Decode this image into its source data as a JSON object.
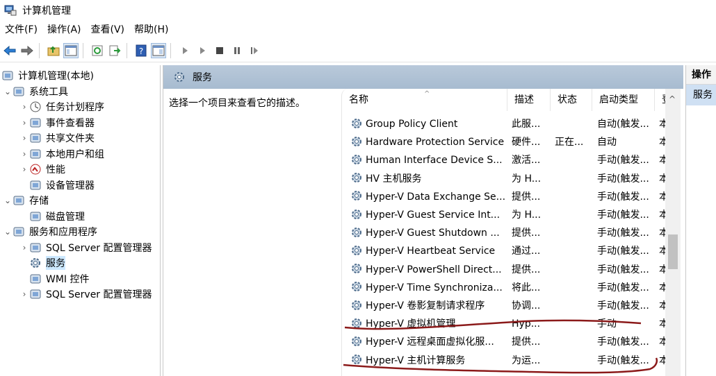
{
  "window": {
    "title": "计算机管理"
  },
  "menu": [
    "文件(F)",
    "操作(A)",
    "查看(V)",
    "帮助(H)"
  ],
  "toolbar_icons": [
    "back-arrow-icon",
    "forward-arrow-icon",
    "up-folder-icon",
    "show-hide-tree-icon",
    "refresh-icon",
    "export-list-icon",
    "help-icon",
    "properties-icon",
    "play-icon",
    "play-alt-icon",
    "stop-icon",
    "pause-icon",
    "restart-icon"
  ],
  "tree": [
    {
      "label": "计算机管理(本地)",
      "level": 0,
      "twisty": "",
      "icon": "computer-management-icon"
    },
    {
      "label": "系统工具",
      "level": 1,
      "twisty": "⌄",
      "icon": "tools-icon"
    },
    {
      "label": "任务计划程序",
      "level": 2,
      "twisty": "›",
      "icon": "clock-icon"
    },
    {
      "label": "事件查看器",
      "level": 2,
      "twisty": "›",
      "icon": "event-viewer-icon"
    },
    {
      "label": "共享文件夹",
      "level": 2,
      "twisty": "›",
      "icon": "shared-folder-icon"
    },
    {
      "label": "本地用户和组",
      "level": 2,
      "twisty": "›",
      "icon": "users-icon"
    },
    {
      "label": "性能",
      "level": 2,
      "twisty": "›",
      "icon": "performance-icon"
    },
    {
      "label": "设备管理器",
      "level": 2,
      "twisty": "",
      "icon": "device-manager-icon"
    },
    {
      "label": "存储",
      "level": 1,
      "twisty": "⌄",
      "icon": "storage-icon"
    },
    {
      "label": "磁盘管理",
      "level": 2,
      "twisty": "",
      "icon": "disk-icon"
    },
    {
      "label": "服务和应用程序",
      "level": 1,
      "twisty": "⌄",
      "icon": "services-apps-icon"
    },
    {
      "label": "SQL Server 配置管理器",
      "level": 2,
      "twisty": "›",
      "icon": "sql-server-icon"
    },
    {
      "label": "服务",
      "level": 2,
      "twisty": "",
      "icon": "gear-icon",
      "selected": true
    },
    {
      "label": "WMI 控件",
      "level": 2,
      "twisty": "",
      "icon": "wmi-icon"
    },
    {
      "label": "SQL Server 配置管理器",
      "level": 2,
      "twisty": "›",
      "icon": "sql-server-icon"
    }
  ],
  "panel": {
    "title": "服务",
    "description": "选择一个项目来查看它的描述。"
  },
  "columns": {
    "name": "名称",
    "description": "描述",
    "status": "状态",
    "startup": "启动类型",
    "logon": "登"
  },
  "services": [
    {
      "name": "Group Policy Client",
      "description": "此服...",
      "status": "",
      "startup": "自动(触发...",
      "logon": "本"
    },
    {
      "name": "Hardware Protection Service",
      "description": "硬件...",
      "status": "正在...",
      "startup": "自动",
      "logon": "本"
    },
    {
      "name": "Human Interface Device S...",
      "description": "激活...",
      "status": "",
      "startup": "手动(触发...",
      "logon": "本"
    },
    {
      "name": "HV 主机服务",
      "description": "为 H...",
      "status": "",
      "startup": "手动(触发...",
      "logon": "本"
    },
    {
      "name": "Hyper-V Data Exchange Se...",
      "description": "提供...",
      "status": "",
      "startup": "手动(触发...",
      "logon": "本"
    },
    {
      "name": "Hyper-V Guest Service Int...",
      "description": "为 H...",
      "status": "",
      "startup": "手动(触发...",
      "logon": "本"
    },
    {
      "name": "Hyper-V Guest Shutdown ...",
      "description": "提供...",
      "status": "",
      "startup": "手动(触发...",
      "logon": "本"
    },
    {
      "name": "Hyper-V Heartbeat Service",
      "description": "通过...",
      "status": "",
      "startup": "手动(触发...",
      "logon": "本"
    },
    {
      "name": "Hyper-V PowerShell Direct...",
      "description": "提供...",
      "status": "",
      "startup": "手动(触发...",
      "logon": "本"
    },
    {
      "name": "Hyper-V Time Synchroniza...",
      "description": "将此...",
      "status": "",
      "startup": "手动(触发...",
      "logon": "本"
    },
    {
      "name": "Hyper-V 卷影复制请求程序",
      "description": "协调...",
      "status": "",
      "startup": "手动(触发...",
      "logon": "本"
    },
    {
      "name": "Hyper-V 虚拟机管理",
      "description": "Hyp...",
      "status": "",
      "startup": "手动",
      "logon": "本"
    },
    {
      "name": "Hyper-V 远程桌面虚拟化服...",
      "description": "提供...",
      "status": "",
      "startup": "手动(触发...",
      "logon": "本"
    },
    {
      "name": "Hyper-V 主机计算服务",
      "description": "为运...",
      "status": "",
      "startup": "手动(触发...",
      "logon": "本"
    }
  ],
  "actions": {
    "header": "操作",
    "selected": "服务"
  },
  "colors": {
    "header_blue": "#a7bbd0",
    "selection": "#cce8ff",
    "annotation": "#8b1a1a"
  }
}
